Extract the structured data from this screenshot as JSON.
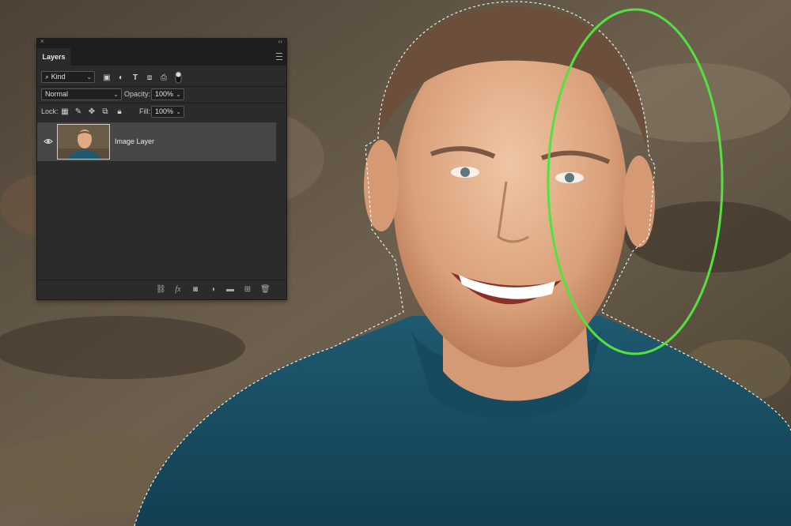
{
  "panel": {
    "close_glyph": "×",
    "collapse_glyph": "‹‹",
    "tab_label": "Layers",
    "menu_icon": "hamburger-menu-icon",
    "filter": {
      "icon": "search-icon",
      "value": "Kind"
    },
    "blend_mode": "Normal",
    "opacity_label": "Opacity:",
    "opacity_value": "100%",
    "lock_label": "Lock:",
    "fill_label": "Fill:",
    "fill_value": "100%",
    "layers": [
      {
        "name": "Image Layer",
        "visible": true
      }
    ]
  },
  "annotation": {
    "color": "#52e23e"
  },
  "colors": {
    "panel_bg": "#2b2b2b",
    "selected_row": "#474747"
  }
}
